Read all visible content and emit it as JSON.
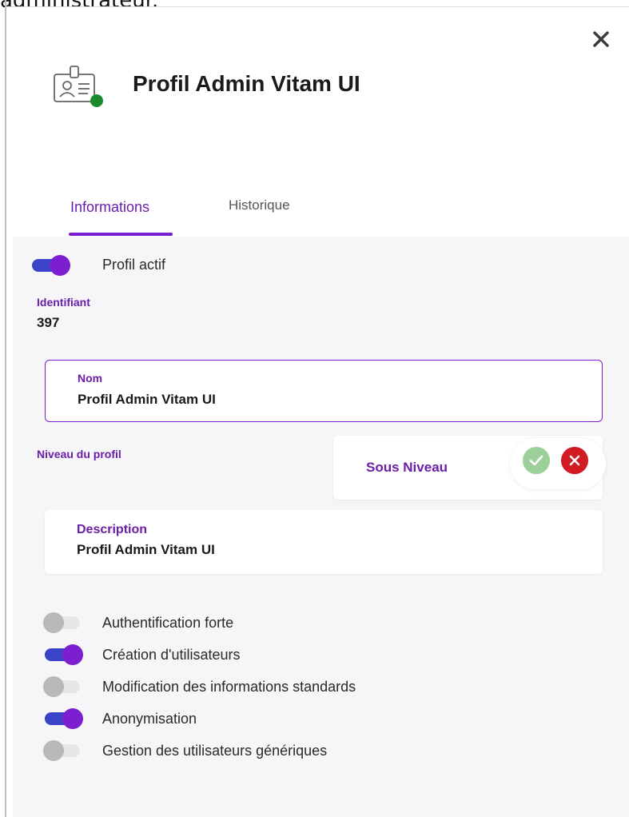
{
  "clipped_text": "administrateur.",
  "header": {
    "title": "Profil Admin Vitam UI",
    "close_icon": "close-icon",
    "profile_icon": "profile-card-icon",
    "status_color": "#1b8a2e"
  },
  "tabs": [
    {
      "label": "Informations",
      "active": true
    },
    {
      "label": "Historique",
      "active": false
    }
  ],
  "active_toggle": {
    "label": "Profil actif",
    "on": true
  },
  "identifier": {
    "label": "Identifiant",
    "value": "397"
  },
  "name_field": {
    "label": "Nom",
    "value": "Profil Admin Vitam UI"
  },
  "level": {
    "label": "Niveau du profil",
    "value": "Sous Niveau"
  },
  "description_field": {
    "label": "Description",
    "value": "Profil Admin Vitam UI"
  },
  "permissions": [
    {
      "label": "Authentification forte",
      "on": false
    },
    {
      "label": "Création d'utilisateurs",
      "on": true
    },
    {
      "label": "Modification des informations standards",
      "on": false
    },
    {
      "label": "Anonymisation",
      "on": true
    },
    {
      "label": "Gestion des utilisateurs génériques",
      "on": false
    }
  ],
  "colors": {
    "accent": "#7b1fd0",
    "toggle_track_on": "#3a44c8",
    "confirm": "#9ccf9a",
    "cancel": "#d11a21"
  }
}
